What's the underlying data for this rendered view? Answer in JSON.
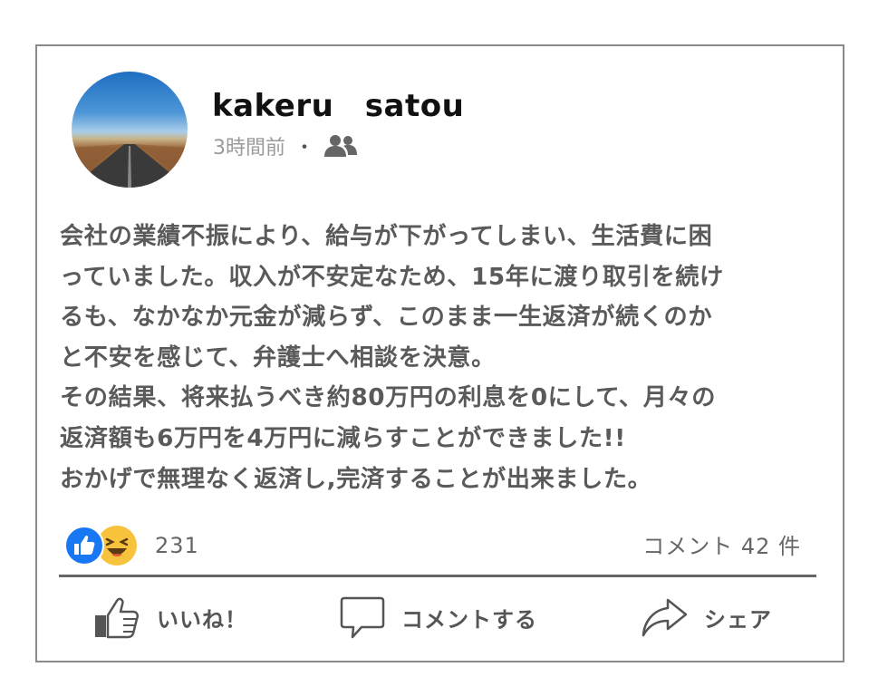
{
  "post": {
    "author": "kakeru　satou",
    "time": "3時間前",
    "separator": "・",
    "audience_icon": "friends-icon",
    "body_lines": [
      "会社の業績不振により、給与が下がってしまい、生活費に困",
      "っていました。収入が不安定なため、15年に渡り取引を続け",
      "るも、なかなか元金が減らず、このまま一生返済が続くのか",
      "と不安を感じて、弁護士へ相談を決意。",
      "その結果、将来払うべき約80万円の利息を0にして、月々の",
      "返済額も6万円を4万円に減らすことができました!!",
      "おかげで無理なく返済し,完済することが出来ました。"
    ]
  },
  "stats": {
    "reaction_icons": [
      "like-icon",
      "haha-icon"
    ],
    "reaction_count": "231",
    "comment_count": "コメント 42 件"
  },
  "actions": {
    "like": "いいね！",
    "comment": "コメントする",
    "share": "シェア"
  },
  "colors": {
    "like_blue": "#1877f2",
    "haha_yellow": "#f7c33c",
    "text_gray": "#5a5a5a"
  }
}
